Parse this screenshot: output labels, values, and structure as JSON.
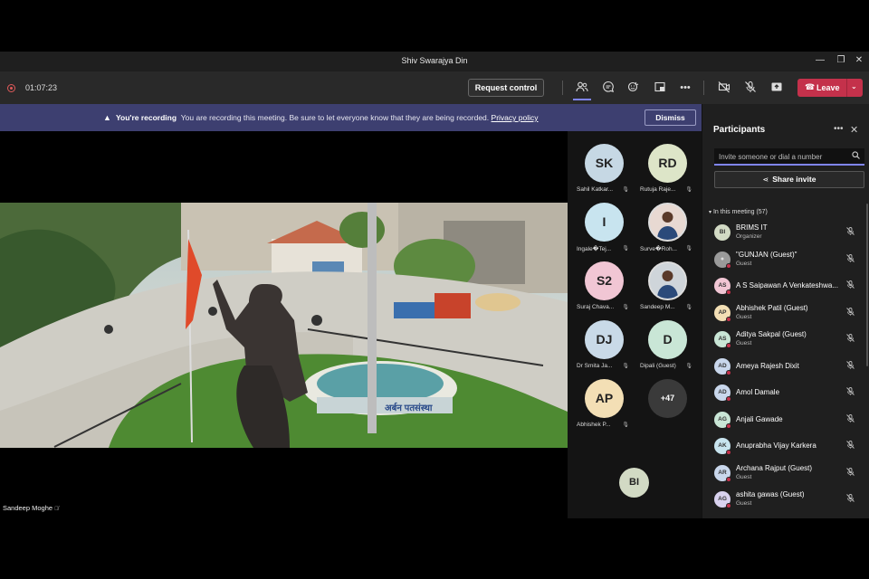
{
  "window": {
    "title": "Shiv Swarajya Din",
    "minimize": "—",
    "restore": "❐",
    "close": "✕"
  },
  "toolbar": {
    "timer": "01:07:23",
    "request_control": "Request control",
    "leave": "Leave"
  },
  "banner": {
    "title": "You're recording",
    "message": "You are recording this meeting. Be sure to let everyone know that they are being recorded.",
    "link": "Privacy policy",
    "dismiss": "Dismiss"
  },
  "stage": {
    "presenter_name": "Sandeep Moghe"
  },
  "video_grid": [
    {
      "initials": "SK",
      "name": "Sahil Katkar...",
      "color": "#c6d8e4"
    },
    {
      "initials": "RD",
      "name": "Rutuja Raje...",
      "color": "#dde5c8"
    },
    {
      "initials": "I",
      "name": "Ingale�Tej...",
      "color": "#c8e4ef"
    },
    {
      "initials": "",
      "name": "Surve�Roh...",
      "color": "#e8d9d2",
      "photo": true
    },
    {
      "initials": "S2",
      "name": "Suraj Chava...",
      "color": "#f1c6d4"
    },
    {
      "initials": "",
      "name": "Sandeep M...",
      "color": "#cfd5da",
      "photo": true
    },
    {
      "initials": "DJ",
      "name": "Dr Smita Ja...",
      "color": "#c9dae8"
    },
    {
      "initials": "D",
      "name": "Dipali (Guest)",
      "color": "#c9e6d6"
    },
    {
      "initials": "AP",
      "name": "Abhishek P...",
      "color": "#f3dfb5"
    },
    {
      "initials": "+47",
      "name": "",
      "color": "#3a3a3a"
    }
  ],
  "solo_tile": {
    "initials": "BI"
  },
  "participants": {
    "title": "Participants",
    "search_placeholder": "Invite someone or dial a number",
    "share_invite": "Share invite",
    "section": "In this meeting (57)",
    "list": [
      {
        "initials": "BI",
        "name": "BRIMS IT",
        "role": "Organizer",
        "color": "#d2dac4",
        "dot": false
      },
      {
        "initials": "",
        "name": "\"GUNJAN (Guest)\"",
        "role": "Guest",
        "color": "#9a9a9a",
        "dot": true
      },
      {
        "initials": "AS",
        "name": "A S Saipawan A Venkateshwa...",
        "role": "",
        "color": "#f1c6d4",
        "dot": true
      },
      {
        "initials": "AP",
        "name": "Abhishek Patil (Guest)",
        "role": "Guest",
        "color": "#f3dfb5",
        "dot": true
      },
      {
        "initials": "AS",
        "name": "Aditya Sakpal (Guest)",
        "role": "Guest",
        "color": "#c9e6d6",
        "dot": true
      },
      {
        "initials": "AD",
        "name": "Ameya Rajesh Dixit",
        "role": "",
        "color": "#c9d7ec",
        "dot": true
      },
      {
        "initials": "AD",
        "name": "Amol Damale",
        "role": "",
        "color": "#c9d7ec",
        "dot": true
      },
      {
        "initials": "AG",
        "name": "Anjali Gawade",
        "role": "",
        "color": "#c9e6d6",
        "dot": true
      },
      {
        "initials": "AK",
        "name": "Anuprabha Vijay Karkera",
        "role": "",
        "color": "#c8e4ef",
        "dot": true
      },
      {
        "initials": "AR",
        "name": "Archana Rajput (Guest)",
        "role": "Guest",
        "color": "#c9d7ec",
        "dot": true
      },
      {
        "initials": "AG",
        "name": "ashita gawas (Guest)",
        "role": "Guest",
        "color": "#d9d2ef",
        "dot": true
      }
    ]
  }
}
